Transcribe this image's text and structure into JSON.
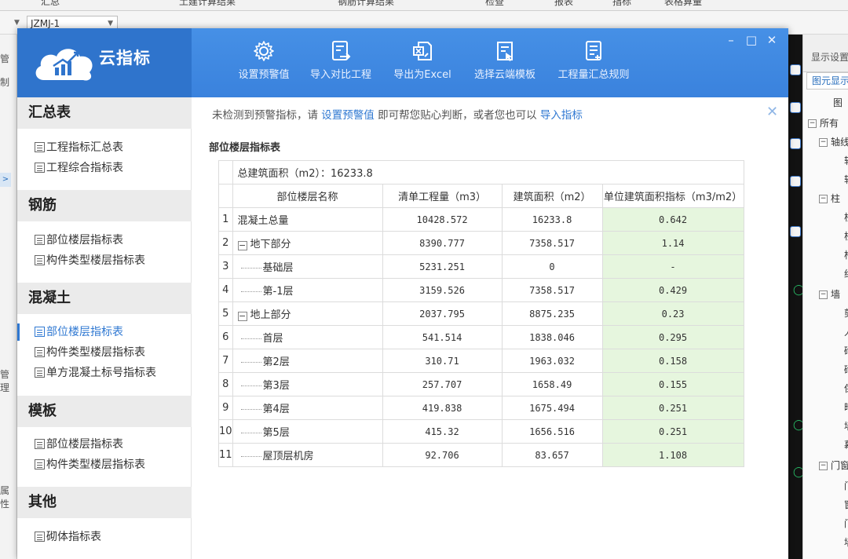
{
  "bg": {
    "top_tabs": [
      "汇总",
      "土建计算结果",
      "钢筋计算结果",
      "检查",
      "报表",
      "指标",
      "表格算量"
    ],
    "select_value": "JZMJ-1",
    "left_labels": [
      "管",
      "制",
      "管理",
      "属性"
    ],
    "right_header": "显示设置",
    "right_tab": "图元显示",
    "right_rows": [
      "图",
      "所有",
      "轴线",
      "轴",
      "轴",
      "柱",
      "柱",
      "柱",
      "构",
      "约",
      "墙",
      "剪",
      "人",
      "砌",
      "砌",
      "保",
      "暗",
      "墙",
      "幕",
      "门窗",
      "门",
      "窗",
      "门",
      "墙"
    ]
  },
  "dialog": {
    "brand_name": "云指标",
    "toolbar": [
      {
        "label": "设置预警值",
        "icon": "gear-icon"
      },
      {
        "label": "导入对比工程",
        "icon": "import-compare-icon"
      },
      {
        "label": "导出为Excel",
        "icon": "export-excel-icon"
      },
      {
        "label": "选择云端模板",
        "icon": "cloud-template-icon"
      },
      {
        "label": "工程量汇总规则",
        "icon": "summary-rules-icon"
      }
    ],
    "window_buttons": {
      "minimize": "–",
      "maximize": "□",
      "close": "✕"
    }
  },
  "sidebar": {
    "sections": [
      {
        "title": "汇总表",
        "items": [
          "工程指标汇总表",
          "工程综合指标表"
        ]
      },
      {
        "title": "钢筋",
        "items": [
          "部位楼层指标表",
          "构件类型楼层指标表"
        ]
      },
      {
        "title": "混凝土",
        "items": [
          "部位楼层指标表",
          "构件类型楼层指标表",
          "单方混凝土标号指标表"
        ]
      },
      {
        "title": "模板",
        "items": [
          "部位楼层指标表",
          "构件类型楼层指标表"
        ]
      },
      {
        "title": "其他",
        "items": [
          "砌体指标表"
        ]
      }
    ],
    "active": "混凝土/部位楼层指标表"
  },
  "notice": {
    "prefix": "未检测到预警指标，请",
    "link1": "设置预警值",
    "middle": "即可帮您贴心判断，或者您也可以",
    "link2": "导入指标"
  },
  "table": {
    "title": "部位楼层指标表",
    "total_area": "总建筑面积（m2）：16233.8",
    "headers": [
      "部位楼层名称",
      "清单工程量（m3）",
      "建筑面积（m2）",
      "单位建筑面积指标（m3/m2）"
    ],
    "rows": [
      {
        "idx": "1",
        "name": "混凝土总量",
        "level": 0,
        "tree": "",
        "qty": "10428.572",
        "area": "16233.8",
        "index": "0.642"
      },
      {
        "idx": "2",
        "name": "地下部分",
        "level": 0,
        "tree": "−",
        "qty": "8390.777",
        "area": "7358.517",
        "index": "1.14"
      },
      {
        "idx": "3",
        "name": "基础层",
        "level": 1,
        "tree": "",
        "qty": "5231.251",
        "area": "0",
        "index": "-"
      },
      {
        "idx": "4",
        "name": "第-1层",
        "level": 1,
        "tree": "",
        "qty": "3159.526",
        "area": "7358.517",
        "index": "0.429"
      },
      {
        "idx": "5",
        "name": "地上部分",
        "level": 0,
        "tree": "−",
        "qty": "2037.795",
        "area": "8875.235",
        "index": "0.23"
      },
      {
        "idx": "6",
        "name": "首层",
        "level": 1,
        "tree": "",
        "qty": "541.514",
        "area": "1838.046",
        "index": "0.295"
      },
      {
        "idx": "7",
        "name": "第2层",
        "level": 1,
        "tree": "",
        "qty": "310.71",
        "area": "1963.032",
        "index": "0.158"
      },
      {
        "idx": "8",
        "name": "第3层",
        "level": 1,
        "tree": "",
        "qty": "257.707",
        "area": "1658.49",
        "index": "0.155"
      },
      {
        "idx": "9",
        "name": "第4层",
        "level": 1,
        "tree": "",
        "qty": "419.838",
        "area": "1675.494",
        "index": "0.251"
      },
      {
        "idx": "10",
        "name": "第5层",
        "level": 1,
        "tree": "",
        "qty": "415.32",
        "area": "1656.516",
        "index": "0.251"
      },
      {
        "idx": "11",
        "name": "屋顶层机房",
        "level": 1,
        "tree": "",
        "qty": "92.706",
        "area": "83.657",
        "index": "1.108"
      }
    ]
  },
  "colors": {
    "header_blue": "#3a82dd",
    "brand_blue": "#2f74cc",
    "link_blue": "#2f78d2",
    "highlight_green": "#e6f6de"
  }
}
